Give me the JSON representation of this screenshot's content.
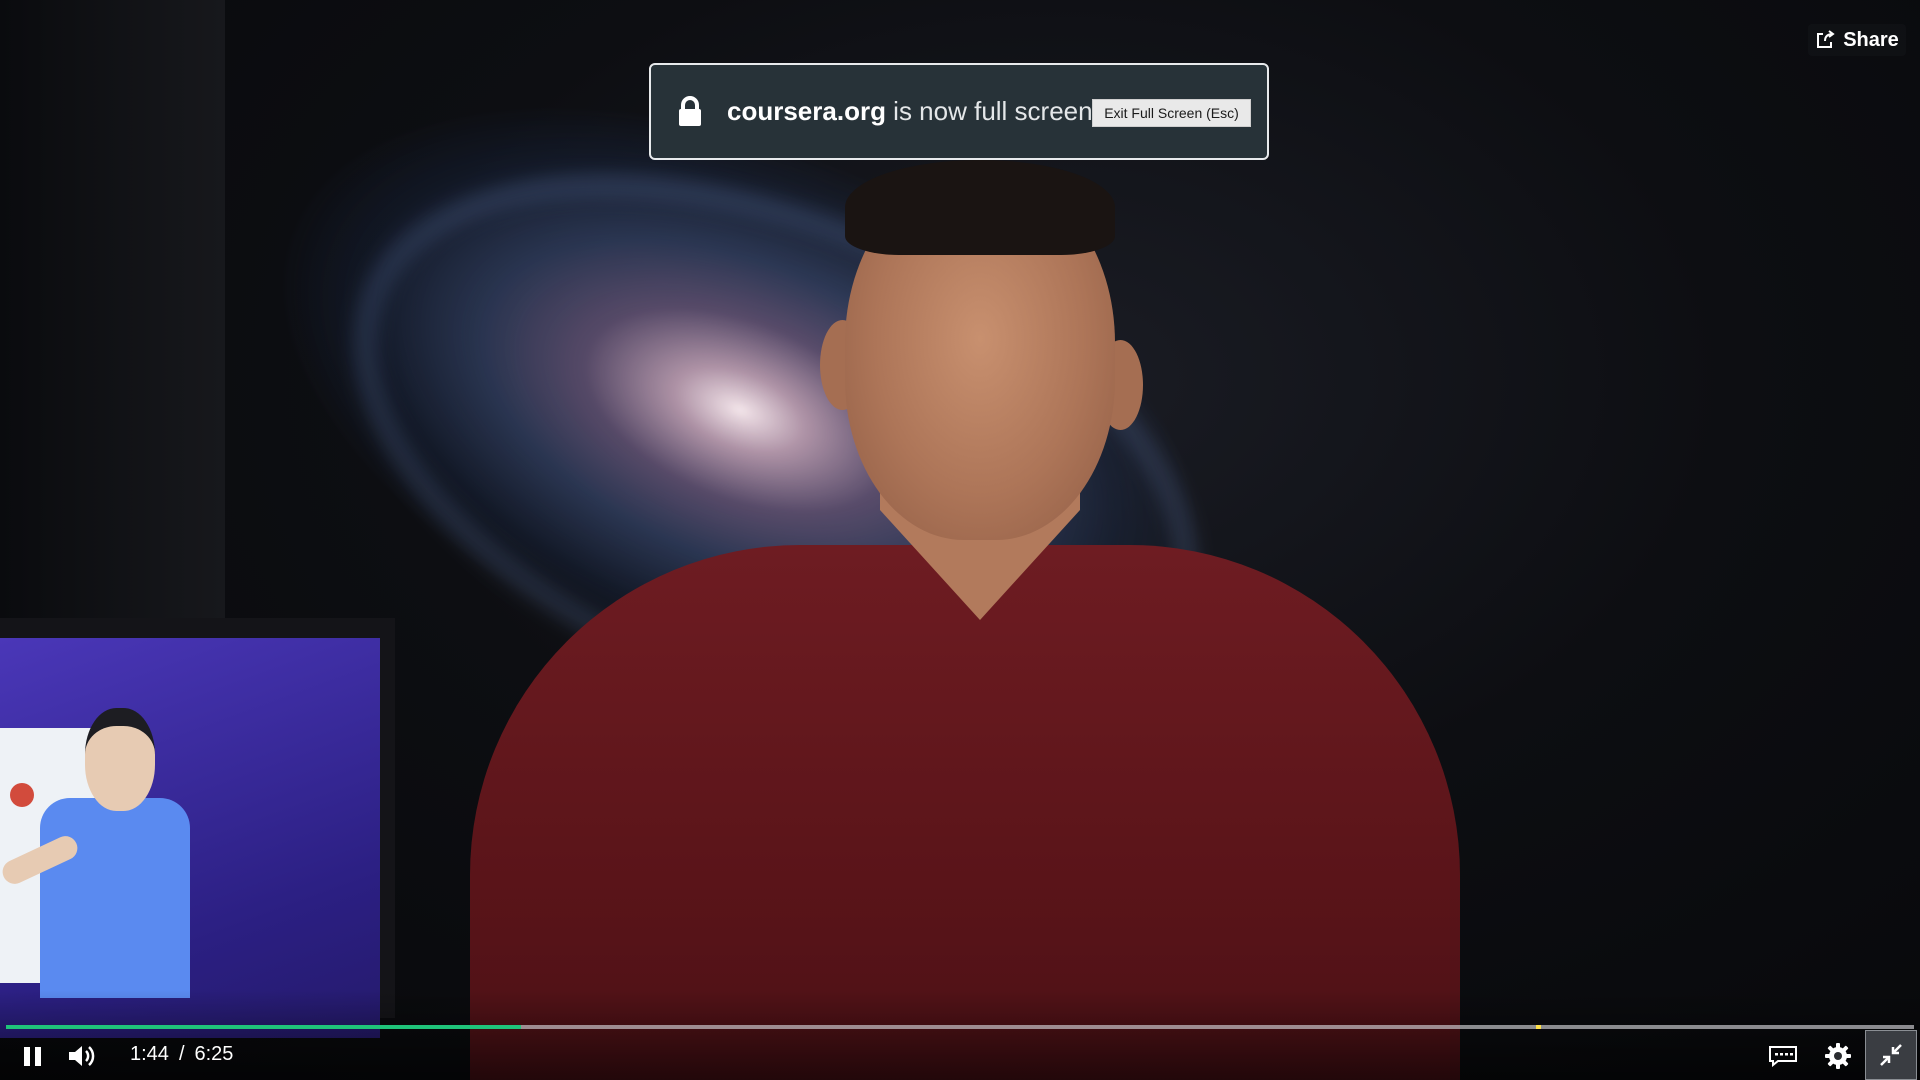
{
  "notification": {
    "domain": "coursera.org",
    "message": " is now full screen",
    "exit_label": "Exit Full Screen (Esc)"
  },
  "share": {
    "label": "Share"
  },
  "player": {
    "current_time": "1:44",
    "separator": "/",
    "duration": "6:25",
    "progress_fraction": 0.27,
    "marker_fraction": 0.802,
    "accent_color": "#1fc47a",
    "marker_color": "#ffe14a"
  },
  "icons": {
    "pause": "pause-icon",
    "volume": "volume-icon",
    "captions": "captions-icon",
    "settings": "gear-icon",
    "exit_fullscreen": "exit-fullscreen-icon",
    "lock": "lock-icon",
    "share": "share-icon"
  }
}
